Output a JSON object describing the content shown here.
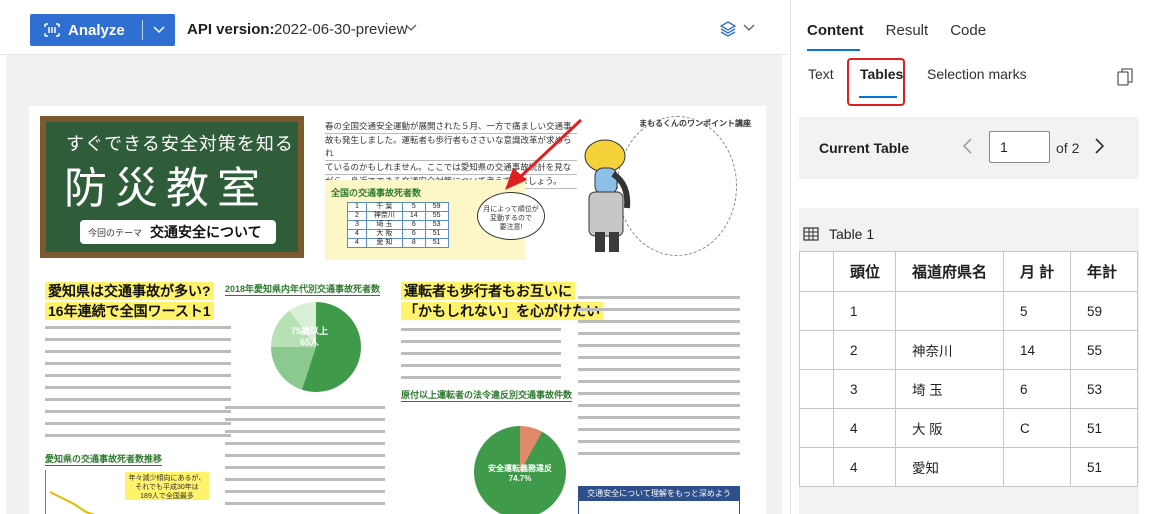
{
  "toolbar": {
    "analyze_label": "Analyze",
    "api_label": "API version:",
    "api_value": "2022-06-30-preview"
  },
  "document": {
    "board_sub": "すぐできる安全対策を知る",
    "board_title": "防災教室",
    "board_theme_small": "今回のテーマ",
    "board_theme": "交通安全について",
    "intro_lines": [
      "春の全国交通安全運動が展開された５月、一方で痛ましい交通事",
      "故も発生しました。運転者も歩行者もささいな意識改革が求められ",
      "ているのかもしれません。ここでは愛知県の交通事故統計を見な",
      "がら、身近でできる交通安全対策について考えてみましょう。"
    ],
    "stat_head": "全国の交通事故死者数",
    "stat_rows": [
      [
        "1",
        "千 葉",
        "5",
        "59"
      ],
      [
        "2",
        "神奈川",
        "14",
        "55"
      ],
      [
        "3",
        "埼 玉",
        "6",
        "53"
      ],
      [
        "4",
        "大 阪",
        "6",
        "51"
      ],
      [
        "4",
        "愛 知",
        "8",
        "51"
      ]
    ],
    "bubble_text": "月によって順位が\n変動するので\n要注意!",
    "callout_title": "まもるくんのワンポイント講座",
    "sec1": "愛知県は交通事故が多い?",
    "sec1b": "16年連続で全国ワースト1",
    "sec2": "2018年愛知県内年代別交通事故死者数",
    "pie_label": "75歳以上\n65人",
    "sec3": "運転者も歩行者もお互いに",
    "sec3b": "「かもしれない」を心がけたい",
    "sec4": "原付以上運転者の法令違反別交通事故件数",
    "donut_label": "安全運転義務違反\n74.7%",
    "sec5": "愛知県の交通事故死者数推移",
    "yellow_note": "年々減少傾向にあるが、\nそれでも平成30年は\n189人で全国最多",
    "blue_box": "交通安全について理解をもっと深めよう"
  },
  "panel": {
    "top_tabs": [
      "Content",
      "Result",
      "Code"
    ],
    "sub_tabs": [
      "Text",
      "Tables",
      "Selection marks"
    ],
    "current_table_label": "Current Table",
    "current_page": "1",
    "of_label": "of 2",
    "table_title": "Table 1",
    "table": {
      "headers": [
        "",
        "頭位",
        "福道府県名",
        "月 計",
        "年計"
      ],
      "rows": [
        [
          "",
          "1",
          "",
          "5",
          "59"
        ],
        [
          "",
          "2",
          "神奈川",
          "14",
          "55"
        ],
        [
          "",
          "3",
          "埼 玉",
          "6",
          "53"
        ],
        [
          "",
          "4",
          "大 阪",
          "C",
          "51"
        ],
        [
          "",
          "4",
          "愛知",
          "",
          "51"
        ]
      ]
    }
  },
  "colors": {
    "accent": "#0078d4",
    "analyze_button": "#2f6fd1",
    "highlight_box": "#e02020"
  }
}
